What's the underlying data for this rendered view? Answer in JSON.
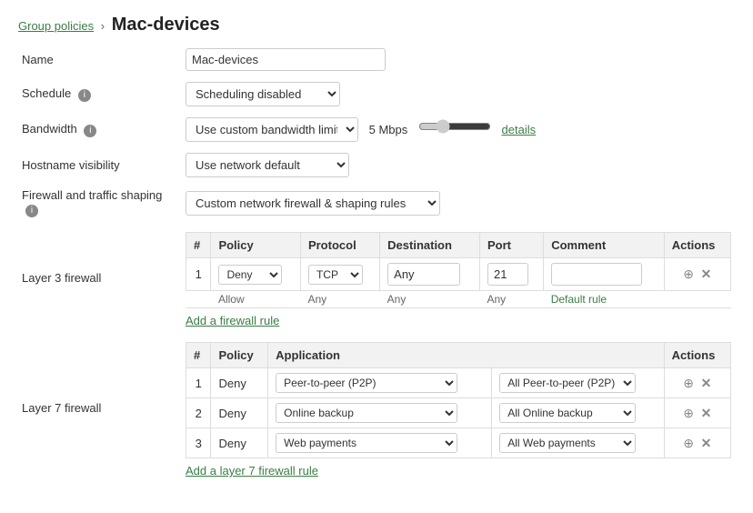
{
  "breadcrumb": {
    "parent_label": "Group policies",
    "separator": "›",
    "current": "Mac-devices"
  },
  "form": {
    "name_label": "Name",
    "name_value": "Mac-devices",
    "schedule_label": "Schedule",
    "schedule_info": "i",
    "schedule_options": [
      "Scheduling disabled"
    ],
    "schedule_selected": "Scheduling disabled",
    "bandwidth_label": "Bandwidth",
    "bandwidth_info": "i",
    "bandwidth_options": [
      "Use custom bandwidth limit"
    ],
    "bandwidth_selected": "Use custom bandwidth limit",
    "bandwidth_mbps": "5 Mbps",
    "details_link": "details",
    "hostname_label": "Hostname visibility",
    "hostname_options": [
      "Use network default"
    ],
    "hostname_selected": "Use network default",
    "firewall_label": "Firewall and traffic shaping",
    "firewall_info": "i",
    "firewall_options": [
      "Custom network firewall & shaping rules"
    ],
    "firewall_selected": "Custom network firewall & shaping rules"
  },
  "layer3": {
    "section_label": "Layer 3 firewall",
    "columns": [
      "#",
      "Policy",
      "Protocol",
      "Destination",
      "Port",
      "Comment",
      "Actions"
    ],
    "rows": [
      {
        "num": "1",
        "policy": "Deny",
        "protocol": "TCP",
        "destination": "Any",
        "port": "21",
        "comment": ""
      }
    ],
    "default_row": {
      "policy": "Allow",
      "protocol": "Any",
      "destination": "Any",
      "port": "Any",
      "comment": "Default rule"
    },
    "add_link": "Add a firewall rule"
  },
  "layer7": {
    "section_label": "Layer 7 firewall",
    "columns": [
      "#",
      "Policy",
      "Application",
      "Actions"
    ],
    "rows": [
      {
        "num": "1",
        "policy": "Deny",
        "application": "Peer-to-peer (P2P)",
        "category": "All Peer-to-peer (P2P)"
      },
      {
        "num": "2",
        "policy": "Deny",
        "application": "Online backup",
        "category": "All Online backup"
      },
      {
        "num": "3",
        "policy": "Deny",
        "application": "Web payments",
        "category": "All Web payments"
      }
    ],
    "add_link": "Add a layer 7 firewall rule"
  },
  "icons": {
    "move": "⊕",
    "delete": "✕"
  }
}
